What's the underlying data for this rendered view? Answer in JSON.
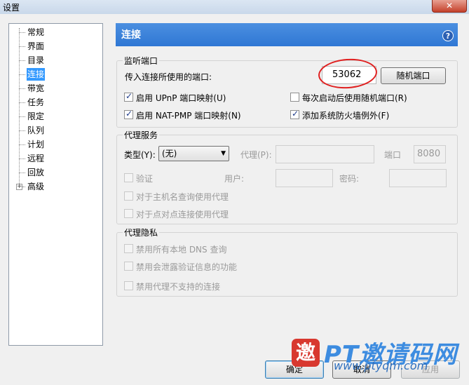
{
  "window": {
    "title": "设置",
    "close_glyph": "✕"
  },
  "tree": {
    "items": [
      {
        "label": "常规"
      },
      {
        "label": "界面"
      },
      {
        "label": "目录"
      },
      {
        "label": "连接"
      },
      {
        "label": "带宽"
      },
      {
        "label": "任务"
      },
      {
        "label": "限定"
      },
      {
        "label": "队列"
      },
      {
        "label": "计划"
      },
      {
        "label": "远程"
      },
      {
        "label": "回放"
      },
      {
        "label": "高级"
      }
    ],
    "expand_glyph": "+"
  },
  "header": {
    "title": "连接",
    "help_glyph": "?"
  },
  "listen": {
    "group_label": "监听端口",
    "port_label": "传入连接所使用的端口:",
    "port_value": "53062",
    "random_button": "随机端口",
    "upnp": {
      "label": "启用 UPnP 端口映射(U)",
      "checked": true
    },
    "natpmp": {
      "label": "启用 NAT-PMP 端口映射(N)",
      "checked": true
    },
    "random_on_start": {
      "label": "每次启动后使用随机端口(R)",
      "checked": false
    },
    "firewall": {
      "label": "添加系统防火墙例外(F)",
      "checked": true
    }
  },
  "proxy": {
    "group_label": "代理服务",
    "type_label": "类型(Y):",
    "type_value": "(无)",
    "proxy_label": "代理(P):",
    "port_label": "端口",
    "port_value": "8080",
    "auth_label": "验证",
    "user_label": "用户:",
    "password_label": "密码:",
    "hostname_label": "对于主机名查询使用代理",
    "peer_label": "对于点对点连接使用代理"
  },
  "privacy": {
    "group_label": "代理隐私",
    "dns_label": "禁用所有本地 DNS 查询",
    "leak_label": "禁用会泄露验证信息的功能",
    "unsupported_label": "禁用代理不支持的连接"
  },
  "footer": {
    "ok": "确定",
    "cancel": "取消",
    "apply": "应用"
  },
  "watermark": {
    "seal": "邀",
    "title": "PT邀请码网",
    "url": "www.ptyqm.com"
  }
}
